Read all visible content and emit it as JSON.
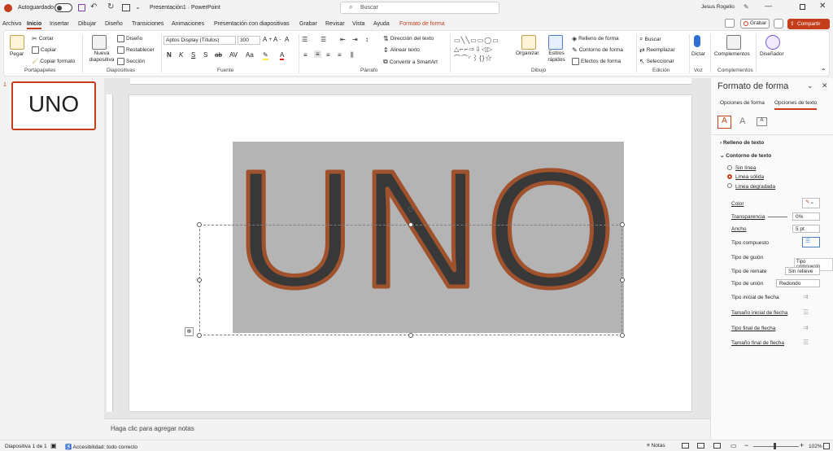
{
  "titlebar": {
    "autosave_label": "Autoguardado",
    "title": "Presentación1 · PowerPoint",
    "search_placeholder": "Buscar",
    "user": "Jesus Rogelio"
  },
  "ribbon_tabs": [
    "Archivo",
    "Inicio",
    "Insertar",
    "Dibujar",
    "Diseño",
    "Transiciones",
    "Animaciones",
    "Presentación con diapositivas",
    "Grabar",
    "Revisar",
    "Vista",
    "Ayuda",
    "Formato de forma"
  ],
  "ribbon_actions": {
    "record": "Grabar",
    "share": "Compartir"
  },
  "clipboard": {
    "paste": "Pegar",
    "cut": "Cortar",
    "copy": "Copiar",
    "format_painter": "Copiar formato",
    "label": "Portapapeles"
  },
  "slides_group": {
    "new_slide": "Nueva diapositiva",
    "layout": "Diseño",
    "reset": "Restablecer",
    "section": "Sección",
    "label": "Diapositivas"
  },
  "font_group": {
    "font_name": "Aptos Display (Títulos)",
    "font_size": "300",
    "label": "Fuente"
  },
  "paragraph_group": {
    "text_direction": "Dirección del texto",
    "align_text": "Alinear texto",
    "smartart": "Convertir a SmartArt",
    "label": "Párrafo"
  },
  "drawing_group": {
    "arrange": "Organizar",
    "quick_styles": "Estilos rápidos",
    "fill": "Relleno de forma",
    "outline": "Contorno de forma",
    "effects": "Efectos de forma",
    "label": "Dibujo"
  },
  "editing_group": {
    "find": "Buscar",
    "replace": "Reemplazar",
    "select": "Seleccionar",
    "label": "Edición"
  },
  "voice_group": {
    "dictate": "Dictar",
    "label": "Voz"
  },
  "addins_group": {
    "addins": "Complementos",
    "designer": "Diseñador",
    "label": "Complementos"
  },
  "thumbnail": {
    "number": "1",
    "text": "UNO"
  },
  "slide": {
    "word": "UNO"
  },
  "notes_placeholder": "Haga clic para agregar notas",
  "status": {
    "slide_info": "Diapositiva 1 de 1",
    "accessibility": "Accesibilidad: todo correcto",
    "notes": "Notas",
    "zoom": "102%"
  },
  "pane": {
    "title": "Formato de forma",
    "tab_shape": "Opciones de forma",
    "tab_text": "Opciones de texto",
    "text_fill": "Relleno de texto",
    "text_outline": "Contorno de texto",
    "no_line": "Sin línea",
    "solid_line": "Línea sólida",
    "gradient_line": "Línea degradada",
    "color": "Color",
    "transparency": "Transparencia",
    "transparency_value": "0%",
    "width": "Ancho",
    "width_value": "5 pt",
    "compound_type": "Tipo compuesto",
    "tooltip": "Tipo compuesto",
    "dash_type": "Tipo de guión",
    "cap_type": "Tipo de remate",
    "cap_value": "Sin relieve",
    "join_type": "Tipo de unión",
    "join_value": "Redondo",
    "begin_arrow_type": "Tipo inicial de flecha",
    "begin_arrow_size": "Tamaño inicial de flecha",
    "end_arrow_type": "Tipo final de flecha",
    "end_arrow_size": "Tamaño final de flecha"
  },
  "colors": {
    "accent": "#c43e1c",
    "outline": "#a0522d",
    "letter_fill": "#383838",
    "shape_fill": "#b4b4b4"
  }
}
